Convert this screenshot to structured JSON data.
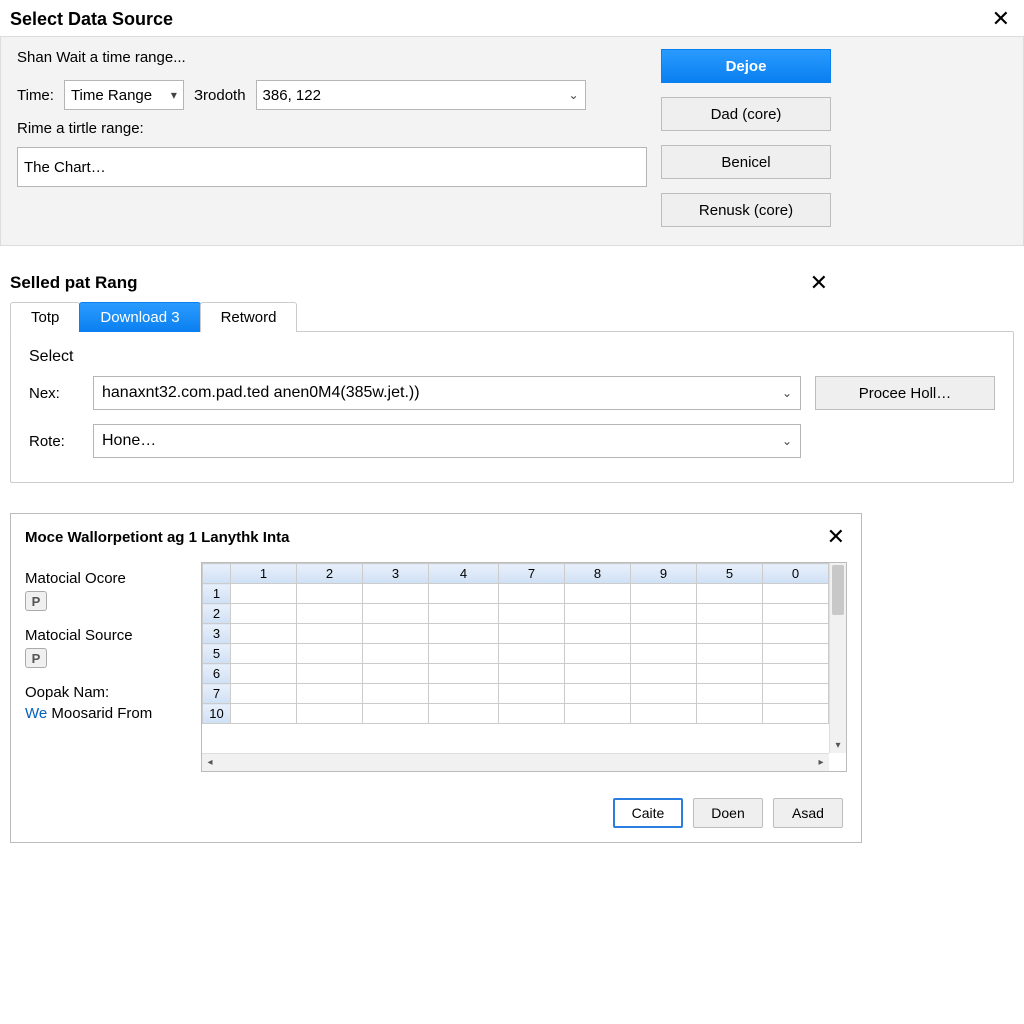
{
  "panel1": {
    "title": "Select Data Source",
    "hint": "Shan Wait a time range...",
    "time_label": "Time:",
    "time_dropdown": "Time Range",
    "brodoth_label": "Зrodoth",
    "brodoth_value": "386, 122",
    "rime_label": "Rime a tirtle range:",
    "chart_input": "The Chart…",
    "buttons": {
      "primary": "Dejoe",
      "b1": "Dad (core)",
      "b2": "Benicel",
      "b3": "Renusk (core)"
    }
  },
  "panel2": {
    "title": "Selled pat Rang",
    "tabs": [
      "Totp",
      "Download 3",
      "Retword"
    ],
    "active_tab": 1,
    "select_label": "Select",
    "nex_label": "Nex:",
    "nex_value": "hanaxnt32.com.pad.ted anen0M4(385w.jet.))",
    "rote_label": "Rote:",
    "rote_value": "Hone…",
    "procee_button": "Procee Holl…"
  },
  "panel3": {
    "title": "Moce Wallorpetiont aɡ 1 Lanythk Inta",
    "side": {
      "label1": "Matocial Ocore",
      "label2": "Matocial Source",
      "label3": "Oopak Nam:",
      "link_prefix": "We",
      "link_text": "Moosarid From",
      "p_badge": "P"
    },
    "grid": {
      "col_headers": [
        "1",
        "2",
        "3",
        "4",
        "7",
        "8",
        "9",
        "5",
        "0"
      ],
      "row_headers": [
        "1",
        "2",
        "3",
        "5",
        "6",
        "7",
        "10"
      ]
    },
    "buttons": {
      "primary": "Caite",
      "b1": "Doen",
      "b2": "Asad"
    }
  }
}
